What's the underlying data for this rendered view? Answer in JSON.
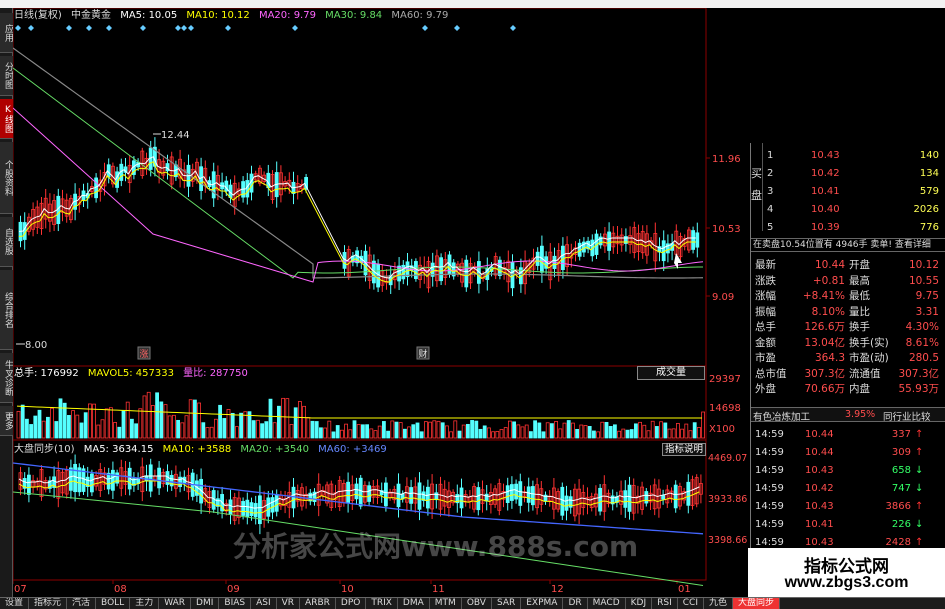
{
  "header": {
    "period": "日线(复权)",
    "stock_name": "中金黄金",
    "ma5": "MA5: 10.05",
    "ma10": "MA10: 10.12",
    "ma20": "MA20: 9.79",
    "ma30": "MA30: 9.84",
    "ma60": "MA60: 9.79"
  },
  "left_tabs": [
    "应用",
    "分时图",
    "K线图",
    "个股资料",
    "自选股",
    "综合排名",
    "牛叉诊断",
    "更多"
  ],
  "price_axis": [
    "11.96",
    "10.53",
    "9.09"
  ],
  "price_annotations": {
    "high": "12.44",
    "low": "8.00",
    "marker1": "涨",
    "marker2": "财"
  },
  "volume_header": {
    "total": "总手: 176992",
    "mavol5": "MAVOL5: 457333",
    "ratio": "量比: 287750",
    "button": "成交量"
  },
  "volume_axis": [
    "29397",
    "14698",
    "X100"
  ],
  "index_header": {
    "name": "大盘同步(10)",
    "ma5": "MA5: 3634.15",
    "ma10": "MA10: +3588",
    "ma20": "MA20: +3540",
    "ma60": "MA60: +3469",
    "button": "指标说明"
  },
  "index_axis": [
    "4469.07",
    "3933.86",
    "3398.66"
  ],
  "x_axis": [
    "07",
    "08",
    "09",
    "10",
    "11",
    "12",
    "01"
  ],
  "watermark_chart": "分析家公式网www.888s.com",
  "order_book": {
    "side_label": "买盘",
    "levels": [
      {
        "lvl": "1",
        "price": "10.43",
        "vol": "140"
      },
      {
        "lvl": "2",
        "price": "10.42",
        "vol": "134"
      },
      {
        "lvl": "3",
        "price": "10.41",
        "vol": "579"
      },
      {
        "lvl": "4",
        "price": "10.40",
        "vol": "2026"
      },
      {
        "lvl": "5",
        "price": "10.39",
        "vol": "776"
      }
    ],
    "info_line": "在卖盘10.54位置有 4946手 卖单! 查看详细"
  },
  "quote": [
    {
      "k1": "最新",
      "v1": "10.44",
      "k2": "开盘",
      "v2": "10.12"
    },
    {
      "k1": "涨跌",
      "v1": "+0.81",
      "k2": "最高",
      "v2": "10.55"
    },
    {
      "k1": "涨幅",
      "v1": "+8.41%",
      "k2": "最低",
      "v2": "9.75"
    },
    {
      "k1": "振幅",
      "v1": "8.10%",
      "k2": "量比",
      "v2": "3.31"
    },
    {
      "k1": "总手",
      "v1": "126.6万",
      "k2": "换手",
      "v2": "4.30%"
    },
    {
      "k1": "金额",
      "v1": "13.04亿",
      "k2": "换手(实)",
      "v2": "8.61%"
    },
    {
      "k1": "市盈",
      "v1": "364.3",
      "k2": "市盈(动)",
      "v2": "280.5"
    },
    {
      "k1": "总市值",
      "v1": "307.3亿",
      "k2": "流通值",
      "v2": "307.3亿"
    },
    {
      "k1": "外盘",
      "v1": "70.66万",
      "k2": "内盘",
      "v2": "55.93万"
    }
  ],
  "industry": {
    "name": "有色冶炼加工",
    "pct": "3.95%",
    "compare": "同行业比较"
  },
  "ticks": [
    {
      "time": "14:59",
      "price": "10.44",
      "vol": "337",
      "dir": "up"
    },
    {
      "time": "14:59",
      "price": "10.44",
      "vol": "309",
      "dir": "up"
    },
    {
      "time": "14:59",
      "price": "10.43",
      "vol": "658",
      "dir": "down"
    },
    {
      "time": "14:59",
      "price": "10.42",
      "vol": "747",
      "dir": "down"
    },
    {
      "time": "14:59",
      "price": "10.43",
      "vol": "3866",
      "dir": "up"
    },
    {
      "time": "14:59",
      "price": "10.41",
      "vol": "226",
      "dir": "down"
    },
    {
      "time": "14:59",
      "price": "10.43",
      "vol": "2428",
      "dir": "up"
    }
  ],
  "bottom_tabs": [
    "设置",
    "指标元",
    "汽活",
    "BOLL",
    "主力",
    "WAR",
    "DMI",
    "BIAS",
    "ASI",
    "VR",
    "ARBR",
    "DPO",
    "TRIX",
    "DMA",
    "MTM",
    "OBV",
    "SAR",
    "EXPMA",
    "DR",
    "MACD",
    "KDJ",
    "RSI",
    "CCI",
    "九色",
    "大盘同步"
  ],
  "badge": {
    "line1": "指标公式网",
    "line2": "www.zbgs3.com"
  },
  "colors": {
    "up": "#ff3333",
    "down": "#55ffff",
    "ma5": "#ffffff",
    "ma10": "#ffff00",
    "ma20": "#ff66ff",
    "ma30": "#66dd66",
    "ma60": "#888888",
    "ma60_index": "#4466ff",
    "bg": "#000000",
    "grid": "#8b0000"
  }
}
